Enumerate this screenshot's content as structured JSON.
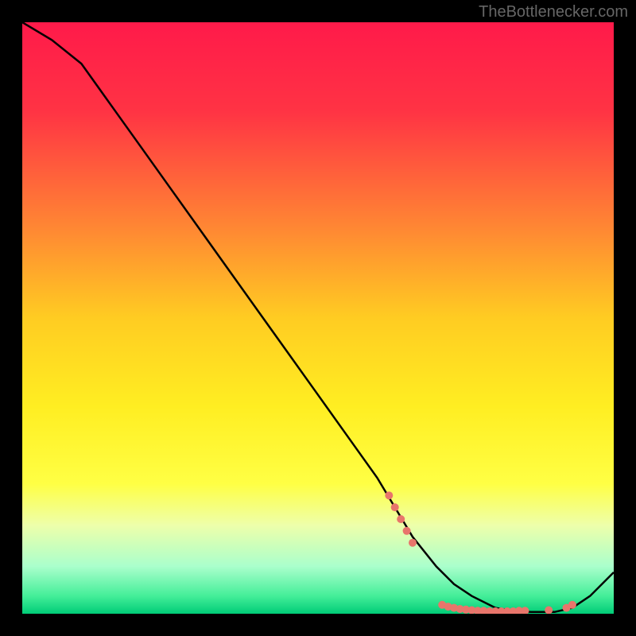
{
  "watermark": "TheBottlenecker.com",
  "chart_data": {
    "type": "line",
    "title": "",
    "xlabel": "",
    "ylabel": "",
    "xlim": [
      0,
      100
    ],
    "ylim": [
      0,
      100
    ],
    "series": [
      {
        "name": "curve",
        "x": [
          0,
          5,
          10,
          15,
          20,
          25,
          30,
          35,
          40,
          45,
          50,
          55,
          60,
          63,
          66,
          70,
          73,
          76,
          80,
          83,
          86,
          90,
          93,
          96,
          100
        ],
        "y": [
          100,
          97,
          93,
          86,
          79,
          72,
          65,
          58,
          51,
          44,
          37,
          30,
          23,
          18,
          13,
          8,
          5,
          3,
          1,
          0.5,
          0.3,
          0.3,
          1,
          3,
          7
        ]
      }
    ],
    "markers": [
      {
        "x": 62,
        "y": 20
      },
      {
        "x": 63,
        "y": 18
      },
      {
        "x": 64,
        "y": 16
      },
      {
        "x": 65,
        "y": 14
      },
      {
        "x": 66,
        "y": 12
      },
      {
        "x": 71,
        "y": 1.5
      },
      {
        "x": 72,
        "y": 1.2
      },
      {
        "x": 73,
        "y": 1
      },
      {
        "x": 74,
        "y": 0.8
      },
      {
        "x": 75,
        "y": 0.7
      },
      {
        "x": 76,
        "y": 0.6
      },
      {
        "x": 77,
        "y": 0.5
      },
      {
        "x": 78,
        "y": 0.5
      },
      {
        "x": 79,
        "y": 0.4
      },
      {
        "x": 80,
        "y": 0.4
      },
      {
        "x": 81,
        "y": 0.4
      },
      {
        "x": 82,
        "y": 0.4
      },
      {
        "x": 83,
        "y": 0.4
      },
      {
        "x": 84,
        "y": 0.5
      },
      {
        "x": 85,
        "y": 0.5
      },
      {
        "x": 89,
        "y": 0.6
      },
      {
        "x": 92,
        "y": 1
      },
      {
        "x": 93,
        "y": 1.5
      }
    ],
    "gradient_stops": [
      {
        "offset": 0,
        "color": "#ff1a4a"
      },
      {
        "offset": 0.15,
        "color": "#ff3344"
      },
      {
        "offset": 0.35,
        "color": "#ff8833"
      },
      {
        "offset": 0.5,
        "color": "#ffcc22"
      },
      {
        "offset": 0.65,
        "color": "#ffee22"
      },
      {
        "offset": 0.78,
        "color": "#ffff44"
      },
      {
        "offset": 0.85,
        "color": "#eeffaa"
      },
      {
        "offset": 0.92,
        "color": "#aaffcc"
      },
      {
        "offset": 0.97,
        "color": "#44ee99"
      },
      {
        "offset": 1,
        "color": "#00cc77"
      }
    ],
    "marker_color": "#e8756b"
  }
}
